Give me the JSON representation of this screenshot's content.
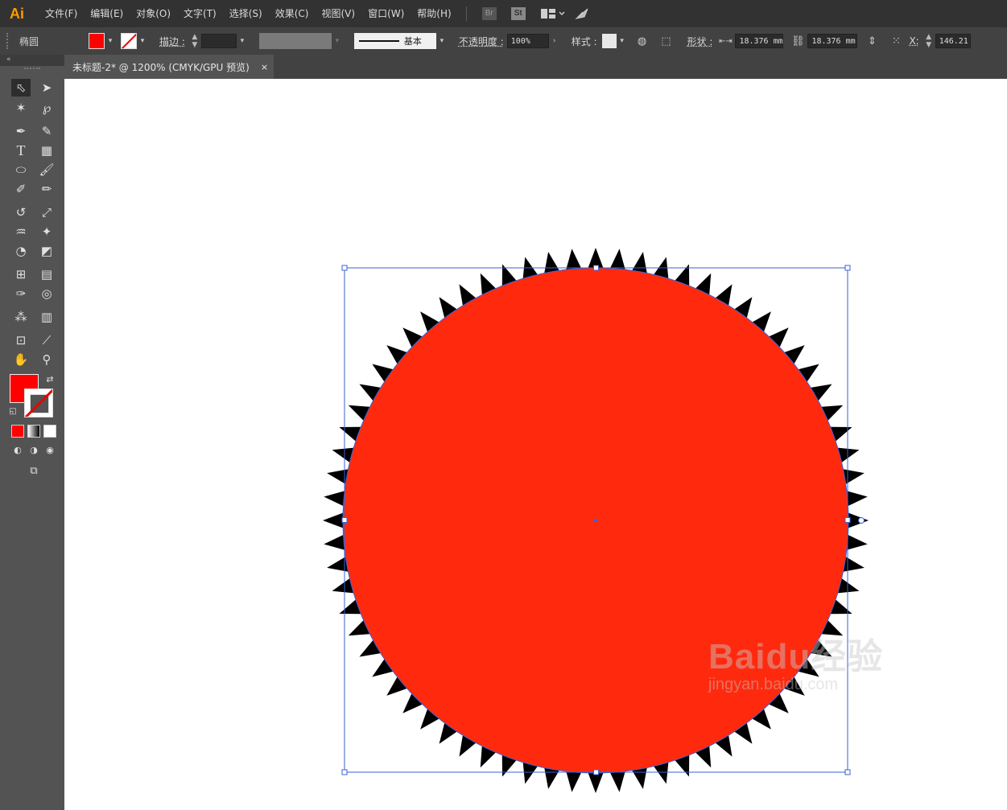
{
  "app": {
    "logo": "Ai",
    "brand_color": "#ff9a00"
  },
  "menu": {
    "items": [
      "文件(F)",
      "编辑(E)",
      "对象(O)",
      "文字(T)",
      "选择(S)",
      "效果(C)",
      "视图(V)",
      "窗口(W)",
      "帮助(H)"
    ],
    "bridge": "Br",
    "stock": "St"
  },
  "control": {
    "object_type": "椭圆",
    "fill_color": "#ff0000",
    "stroke_label": "描边 :",
    "brush_label": "基本",
    "opacity_label": "不透明度 :",
    "opacity_value": "100%",
    "style_label": "样式 :",
    "shape_label": "形状 :",
    "width_value": "18.376 mm",
    "height_value": "18.376 mm",
    "x_label": "X:",
    "x_value": "146.21"
  },
  "document": {
    "tab_title": "未标题-2* @ 1200% (CMYK/GPU 预览)",
    "close_glyph": "×"
  },
  "artwork": {
    "circle_fill": "#ff2a0e",
    "spike_fill": "#000000",
    "selection_color": "#3a62d6",
    "spike_count": 72
  },
  "watermark": {
    "brand": "Baidu经验",
    "url": "jingyan.baidu.com"
  }
}
